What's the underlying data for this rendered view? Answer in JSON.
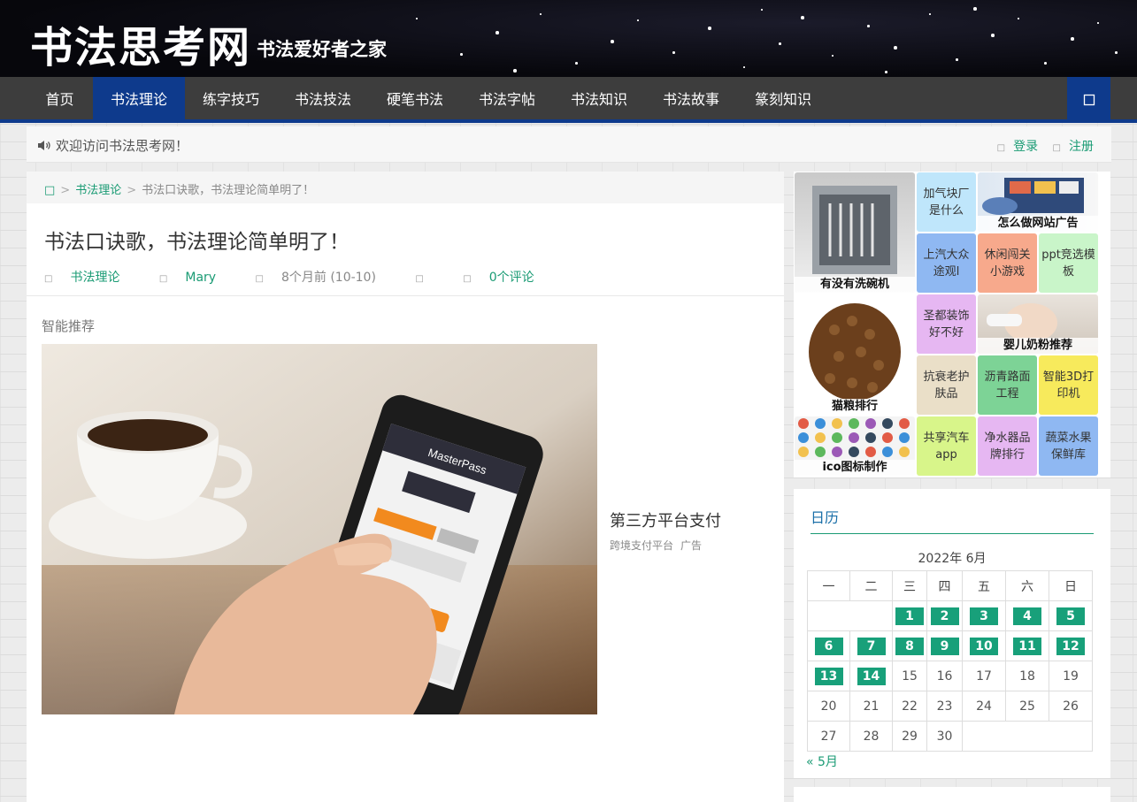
{
  "header": {
    "logo": "书法思考网",
    "slogan": "书法爱好者之家"
  },
  "nav": {
    "items": [
      "首页",
      "书法理论",
      "练字技巧",
      "书法技法",
      "硬笔书法",
      "书法字帖",
      "书法知识",
      "书法故事",
      "篆刻知识"
    ],
    "active": "书法理论",
    "search_icon": "search-icon"
  },
  "notice": {
    "text": "欢迎访问书法思考网！",
    "login": "登录",
    "register": "注册"
  },
  "breadcrumb": {
    "home_icon": "home-icon",
    "category": "书法理论",
    "current": "书法口诀歌，书法理论简单明了！"
  },
  "article": {
    "title": "书法口诀歌，书法理论简单明了！",
    "category": "书法理论",
    "author": "Mary",
    "time": "8个月前 (10-10)",
    "comments": "0个评论"
  },
  "recommend": {
    "label": "智能推荐",
    "ad_title": "第三方平台支付",
    "ad_source": "跨境支付平台",
    "ad_tag": "广告"
  },
  "sidebar_tiles": {
    "dishwasher": "有没有洗碗机",
    "gas": "加气块厂是什么",
    "website_ad": "怎么做网站广告",
    "saic": "上汽大众途观l",
    "casual_game": "休闲闯关小游戏",
    "ppt": "ppt竞选模板",
    "cat_food": "猫粮排行",
    "shengdu": "圣都装饰好不好",
    "milk": "婴儿奶粉推荐",
    "skincare": "抗衰老护肤品",
    "asphalt": "沥青路面工程",
    "printer": "智能3D打印机",
    "ico": "ico图标制作",
    "carshare": "共享汽车app",
    "water": "净水器品牌排行",
    "veg": "蔬菜水果保鲜库"
  },
  "tile_colors": {
    "gas": "#bfe6fb",
    "saic": "#8fb8f2",
    "casual_game": "#f7a98c",
    "ppt": "#c9f5c9",
    "shengdu": "#e6b7f2",
    "skincare": "#eadfc8",
    "asphalt": "#7dd396",
    "printer": "#f7ea5c",
    "carshare": "#d8f58a",
    "water": "#e6b7f2",
    "veg": "#8fb8f2"
  },
  "calendar": {
    "title": "日历",
    "caption": "2022年 6月",
    "weekdays": [
      "一",
      "二",
      "三",
      "四",
      "五",
      "六",
      "日"
    ],
    "days": [
      "1",
      "2",
      "3",
      "4",
      "5",
      "6",
      "7",
      "8",
      "9",
      "10",
      "11",
      "12",
      "13",
      "14",
      "15",
      "16",
      "17",
      "18",
      "19",
      "20",
      "21",
      "22",
      "23",
      "24",
      "25",
      "26",
      "27",
      "28",
      "29",
      "30"
    ],
    "first_weekday_index": 2,
    "linked_through": 14,
    "prev": "« 5月"
  }
}
